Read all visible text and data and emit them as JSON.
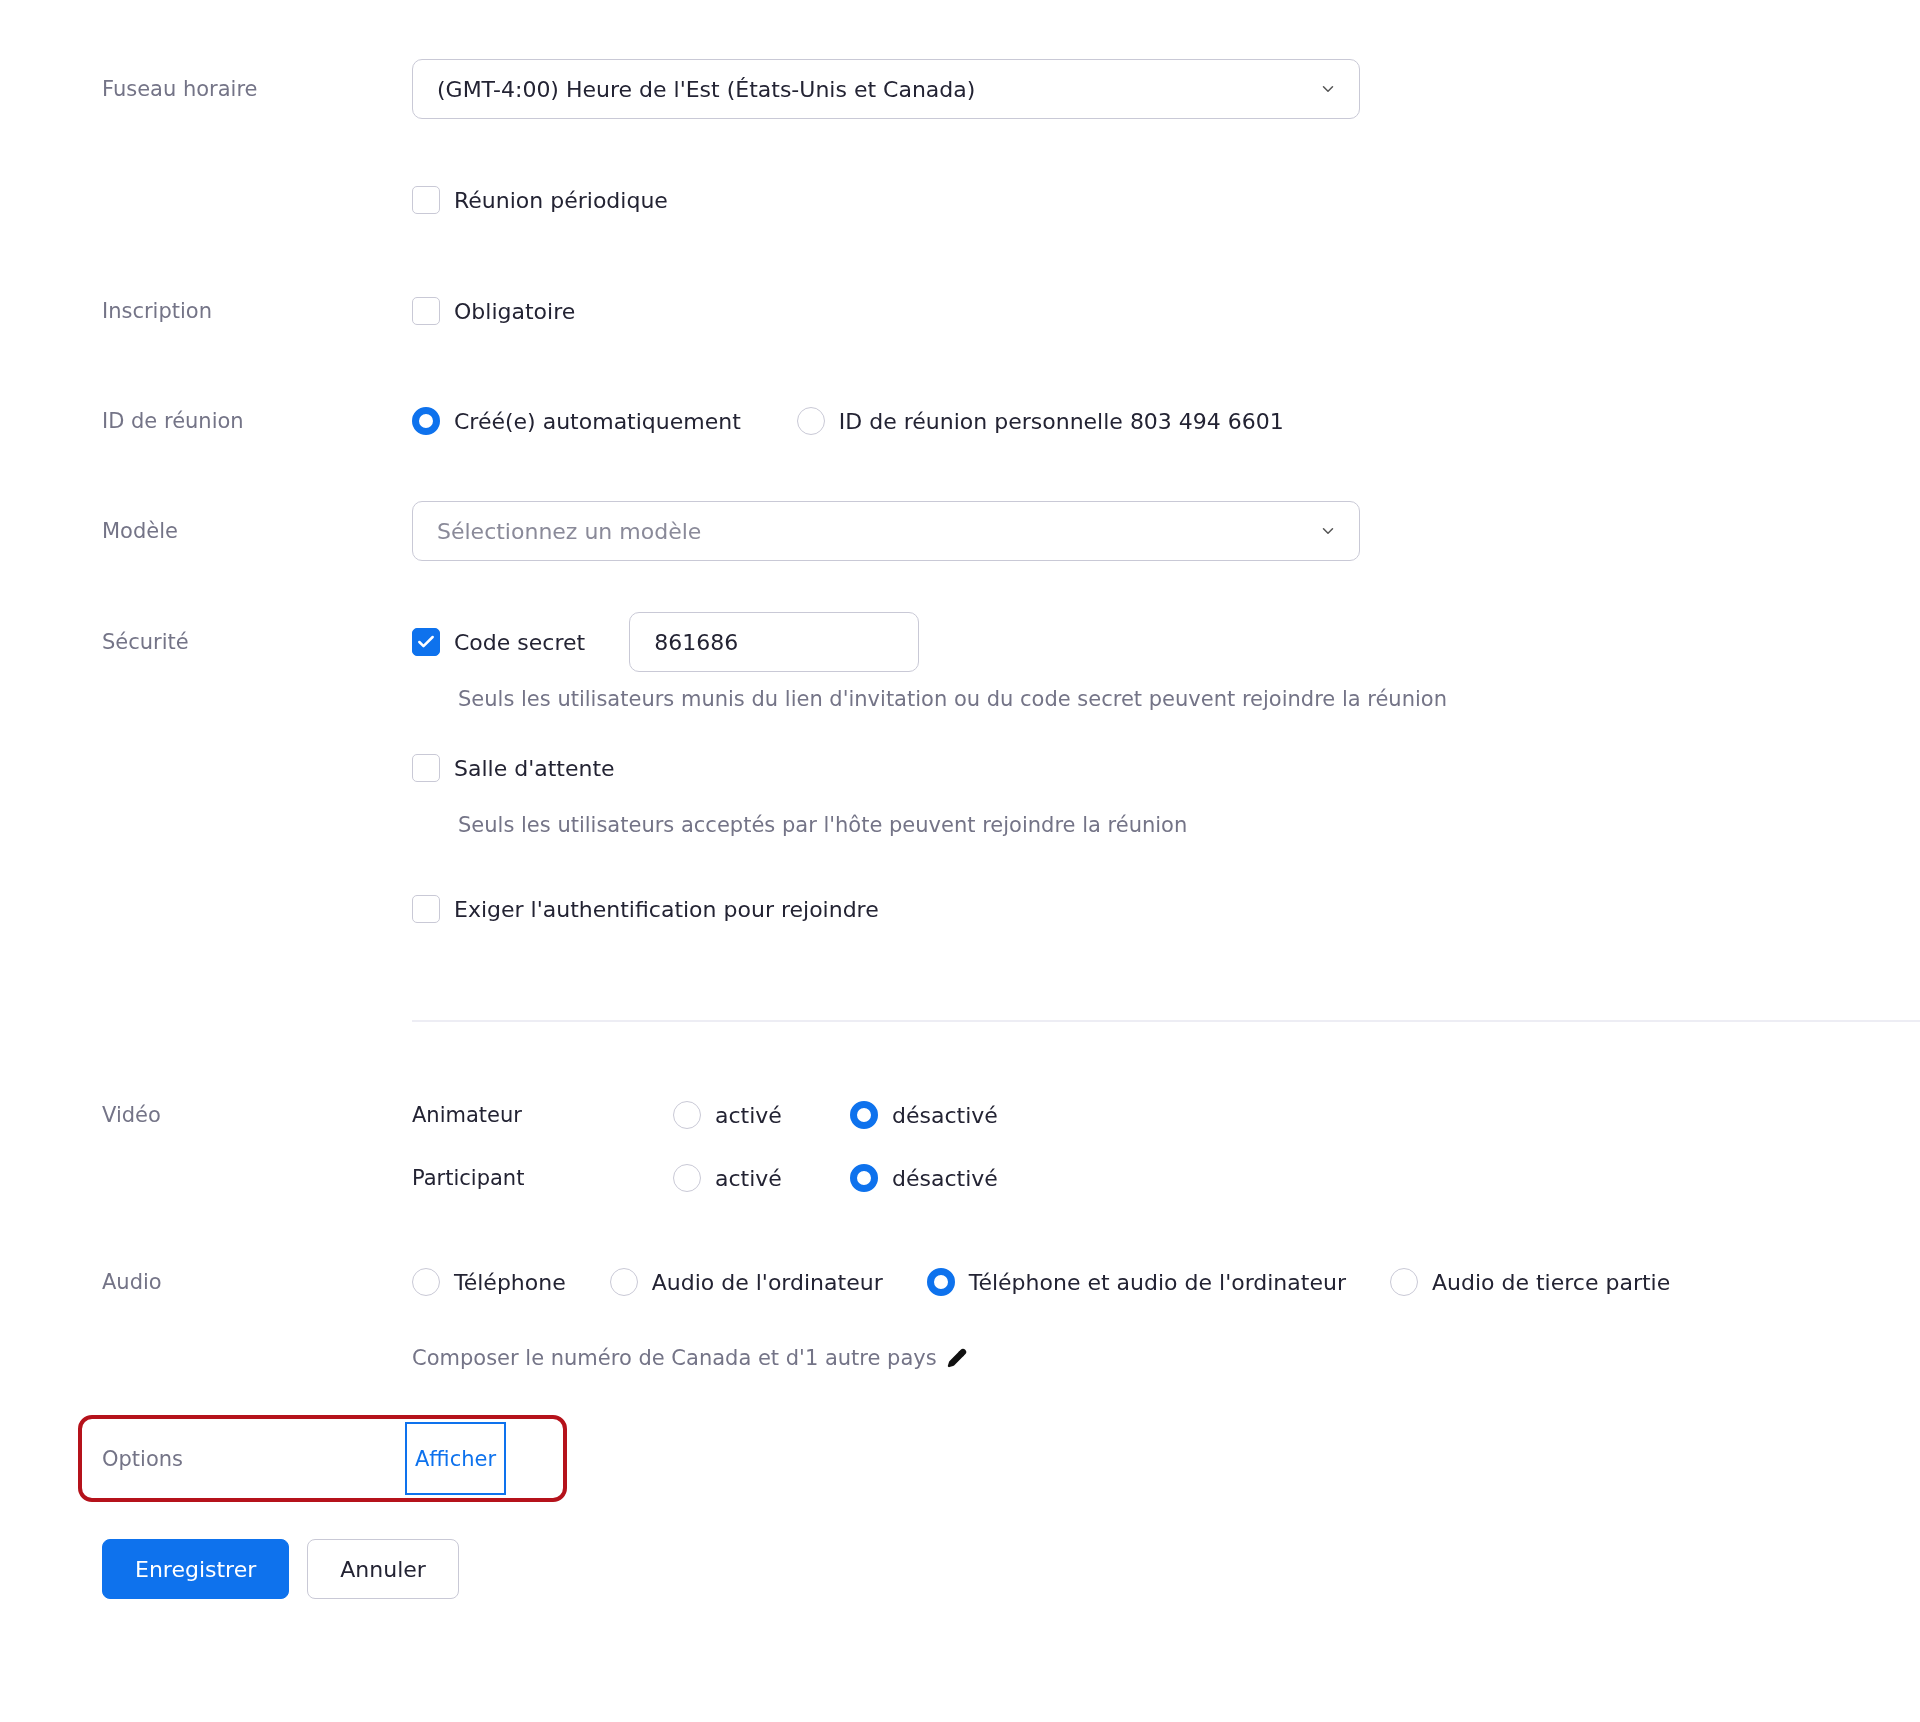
{
  "timezone": {
    "label": "Fuseau horaire",
    "value": "(GMT-4:00) Heure de l'Est (États-Unis et Canada)"
  },
  "recurring": {
    "label": "Réunion périodique",
    "checked": false
  },
  "registration": {
    "label": "Inscription",
    "option": {
      "label": "Obligatoire",
      "checked": false
    }
  },
  "meeting_id": {
    "label": "ID de réunion",
    "options": [
      {
        "label": "Créé(e) automatiquement",
        "selected": true
      },
      {
        "label": "ID de réunion personnelle 803 494 6601",
        "selected": false
      }
    ]
  },
  "template": {
    "label": "Modèle",
    "placeholder": "Sélectionnez un modèle"
  },
  "security": {
    "label": "Sécurité",
    "items": [
      {
        "label": "Code secret",
        "checked": true,
        "value": "861686",
        "hint": "Seuls les utilisateurs munis du lien d'invitation ou du code secret peuvent rejoindre la réunion"
      },
      {
        "label": "Salle d'attente",
        "checked": false,
        "hint": "Seuls les utilisateurs acceptés par l'hôte peuvent rejoindre la réunion"
      },
      {
        "label": "Exiger l'authentification pour rejoindre",
        "checked": false
      }
    ]
  },
  "video": {
    "label": "Vidéo",
    "rows": [
      {
        "name": "Animateur",
        "options": [
          {
            "label": "activé",
            "selected": false
          },
          {
            "label": "désactivé",
            "selected": true
          }
        ]
      },
      {
        "name": "Participant",
        "options": [
          {
            "label": "activé",
            "selected": false
          },
          {
            "label": "désactivé",
            "selected": true
          }
        ]
      }
    ]
  },
  "audio": {
    "label": "Audio",
    "options": [
      {
        "label": "Téléphone",
        "selected": false
      },
      {
        "label": "Audio de l'ordinateur",
        "selected": false
      },
      {
        "label": "Téléphone et audio de l'ordinateur",
        "selected": true
      },
      {
        "label": "Audio de tierce partie",
        "selected": false
      }
    ],
    "dial_in": "Composer le numéro de Canada et d'1 autre pays"
  },
  "options": {
    "label": "Options",
    "link": "Afficher"
  },
  "buttons": [
    {
      "label": "Enregistrer",
      "kind": "primary"
    },
    {
      "label": "Annuler",
      "kind": "secondary"
    }
  ]
}
